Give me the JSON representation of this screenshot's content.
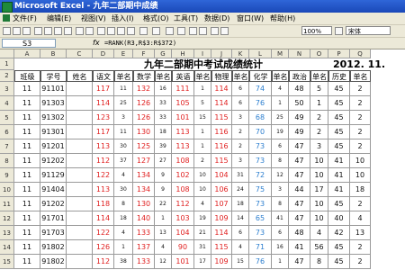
{
  "window": {
    "title": "Microsoft Excel - 九年二部期中成绩"
  },
  "menu": [
    "文件(F)",
    "编辑(E)",
    "视图(V)",
    "插入(I)",
    "格式(O)",
    "工具(T)",
    "数据(D)",
    "窗口(W)",
    "帮助(H)"
  ],
  "toolbar": {
    "zoom": "100%",
    "font": "宋体"
  },
  "formula_bar": {
    "name_box": "S3",
    "fx": "fx",
    "formula": "=RANK(R3,R$3:R$372)"
  },
  "columns": [
    "A",
    "B",
    "C",
    "D",
    "E",
    "F",
    "G",
    "H",
    "I",
    "J",
    "K",
    "L",
    "M",
    "N",
    "O",
    "P",
    "Q"
  ],
  "sheet_title": "九年二部期中考试成绩统计",
  "sheet_date": "2012. 11.",
  "headers": [
    "班级",
    "学号",
    "姓名",
    "语文",
    "单名",
    "数学",
    "单名",
    "英语",
    "单名",
    "物理",
    "单名",
    "化学",
    "单名",
    "政治",
    "单名",
    "历史",
    "单名"
  ],
  "rows": [
    {
      "n": "3",
      "c": [
        "11",
        "91101",
        "",
        "117",
        "11",
        "132",
        "16",
        "111",
        "1",
        "114",
        "6",
        "74",
        "4",
        "48",
        "5",
        "45",
        "2"
      ]
    },
    {
      "n": "4",
      "c": [
        "11",
        "91303",
        "",
        "114",
        "25",
        "126",
        "33",
        "105",
        "5",
        "114",
        "6",
        "76",
        "1",
        "50",
        "1",
        "45",
        "2"
      ]
    },
    {
      "n": "5",
      "c": [
        "11",
        "91302",
        "",
        "123",
        "3",
        "126",
        "33",
        "101",
        "15",
        "115",
        "3",
        "68",
        "25",
        "49",
        "2",
        "45",
        "2"
      ]
    },
    {
      "n": "6",
      "c": [
        "11",
        "91301",
        "",
        "117",
        "11",
        "130",
        "18",
        "113",
        "1",
        "116",
        "2",
        "70",
        "19",
        "49",
        "2",
        "45",
        "2"
      ]
    },
    {
      "n": "7",
      "c": [
        "11",
        "91201",
        "",
        "113",
        "30",
        "125",
        "39",
        "113",
        "1",
        "116",
        "2",
        "73",
        "6",
        "47",
        "3",
        "45",
        "2"
      ]
    },
    {
      "n": "8",
      "c": [
        "11",
        "91202",
        "",
        "112",
        "37",
        "127",
        "27",
        "108",
        "2",
        "115",
        "3",
        "73",
        "8",
        "47",
        "10",
        "41",
        "10"
      ]
    },
    {
      "n": "9",
      "c": [
        "11",
        "91129",
        "",
        "122",
        "4",
        "134",
        "9",
        "102",
        "10",
        "104",
        "31",
        "72",
        "12",
        "47",
        "10",
        "41",
        "10"
      ]
    },
    {
      "n": "10",
      "c": [
        "11",
        "91404",
        "",
        "113",
        "30",
        "134",
        "9",
        "108",
        "10",
        "106",
        "24",
        "75",
        "3",
        "44",
        "17",
        "41",
        "18"
      ]
    },
    {
      "n": "11",
      "c": [
        "11",
        "91202",
        "",
        "118",
        "8",
        "130",
        "22",
        "112",
        "4",
        "107",
        "18",
        "73",
        "8",
        "47",
        "10",
        "45",
        "2"
      ]
    },
    {
      "n": "12",
      "c": [
        "11",
        "91701",
        "",
        "114",
        "18",
        "140",
        "1",
        "103",
        "19",
        "109",
        "14",
        "65",
        "41",
        "47",
        "10",
        "40",
        "4"
      ]
    },
    {
      "n": "13",
      "c": [
        "11",
        "91703",
        "",
        "122",
        "4",
        "133",
        "13",
        "104",
        "21",
        "114",
        "6",
        "73",
        "6",
        "48",
        "4",
        "42",
        "13"
      ]
    },
    {
      "n": "14",
      "c": [
        "11",
        "91802",
        "",
        "126",
        "1",
        "137",
        "4",
        "90",
        "31",
        "115",
        "4",
        "71",
        "16",
        "41",
        "56",
        "45",
        "2"
      ]
    },
    {
      "n": "15",
      "c": [
        "11",
        "91802",
        "",
        "112",
        "38",
        "133",
        "12",
        "101",
        "17",
        "109",
        "15",
        "76",
        "1",
        "47",
        "8",
        "45",
        "2"
      ]
    }
  ],
  "colors": {
    "score_red": "#e02020",
    "science_blue": "#2d7fcf",
    "selection": "#000000"
  }
}
